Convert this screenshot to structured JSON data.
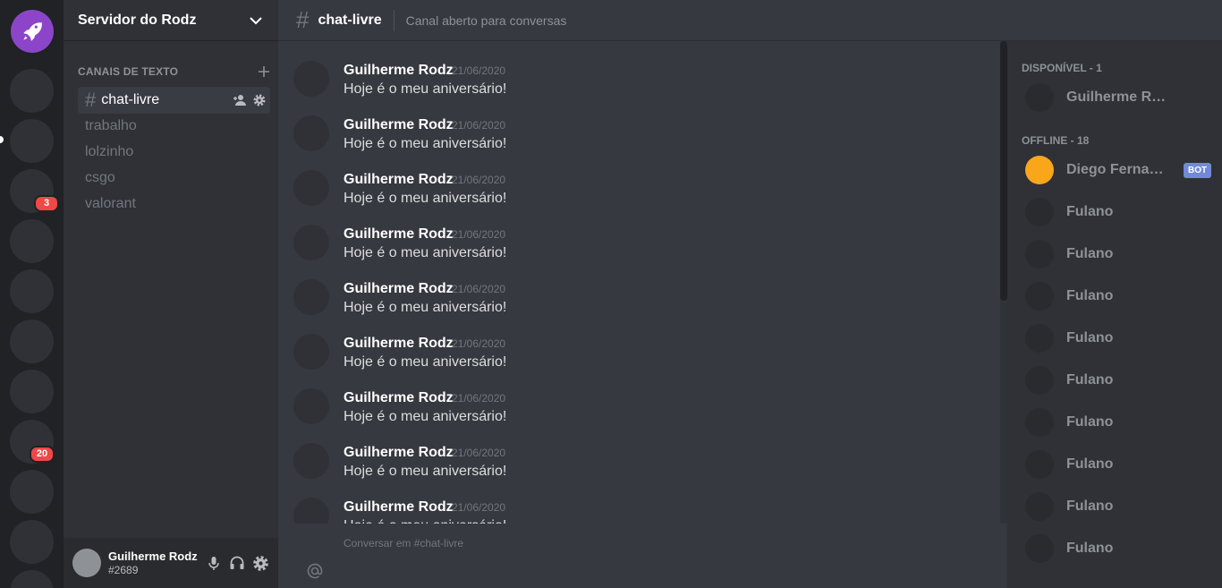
{
  "guild": {
    "name": "Servidor do Rodz"
  },
  "servers": [
    {
      "badge": ""
    },
    {
      "badge": ""
    },
    {
      "badge": "3"
    },
    {
      "badge": ""
    },
    {
      "badge": ""
    },
    {
      "badge": ""
    },
    {
      "badge": ""
    },
    {
      "badge": "20"
    },
    {
      "badge": ""
    },
    {
      "badge": ""
    },
    {
      "badge": ""
    }
  ],
  "category": {
    "label": "CANAIS DE TEXTO"
  },
  "channels": [
    {
      "name": "chat-livre",
      "active": true
    },
    {
      "name": "trabalho"
    },
    {
      "name": "lolzinho"
    },
    {
      "name": "csgo"
    },
    {
      "name": "valorant"
    }
  ],
  "user": {
    "name": "Guilherme Rodz",
    "tag": "#2689"
  },
  "chat": {
    "title": "chat-livre",
    "topic": "Canal aberto para conversas",
    "composer_placeholder": "Conversar em #chat-livre"
  },
  "messages": [
    {
      "author": "Guilherme Rodz",
      "date": "21/06/2020",
      "text": "Hoje é o meu aniversário!"
    },
    {
      "author": "Guilherme Rodz",
      "date": "21/06/2020",
      "text": "Hoje é o meu aniversário!"
    },
    {
      "author": "Guilherme Rodz",
      "date": "21/06/2020",
      "text": "Hoje é o meu aniversário!"
    },
    {
      "author": "Guilherme Rodz",
      "date": "21/06/2020",
      "text": "Hoje é o meu aniversário!"
    },
    {
      "author": "Guilherme Rodz",
      "date": "21/06/2020",
      "text": "Hoje é o meu aniversário!"
    },
    {
      "author": "Guilherme Rodz",
      "date": "21/06/2020",
      "text": "Hoje é o meu aniversário!"
    },
    {
      "author": "Guilherme Rodz",
      "date": "21/06/2020",
      "text": "Hoje é o meu aniversário!"
    },
    {
      "author": "Guilherme Rodz",
      "date": "21/06/2020",
      "text": "Hoje é o meu aniversário!"
    },
    {
      "author": "Guilherme Rodz",
      "date": "21/06/2020",
      "text": "Hoje é o meu aniversário!"
    }
  ],
  "members": {
    "online_header": "DISPONÍVEL - 1",
    "online": [
      {
        "name": "Guilherme Rodz"
      }
    ],
    "offline_header": "OFFLINE - 18",
    "offline": [
      {
        "name": "Diego Fernandes",
        "bot_tag": "BOT",
        "avatar_color": "#faa61a"
      },
      {
        "name": "Fulano"
      },
      {
        "name": "Fulano"
      },
      {
        "name": "Fulano"
      },
      {
        "name": "Fulano"
      },
      {
        "name": "Fulano"
      },
      {
        "name": "Fulano"
      },
      {
        "name": "Fulano"
      },
      {
        "name": "Fulano"
      },
      {
        "name": "Fulano"
      }
    ]
  },
  "colors": {
    "accent": "#8c45c9",
    "badge": "#f04747",
    "bot": "#7289da"
  },
  "icons": [
    "rocket-icon",
    "chevron-down-icon",
    "plus-icon",
    "add-member-icon",
    "gear-icon",
    "microphone-icon",
    "headphones-icon",
    "at-icon"
  ]
}
